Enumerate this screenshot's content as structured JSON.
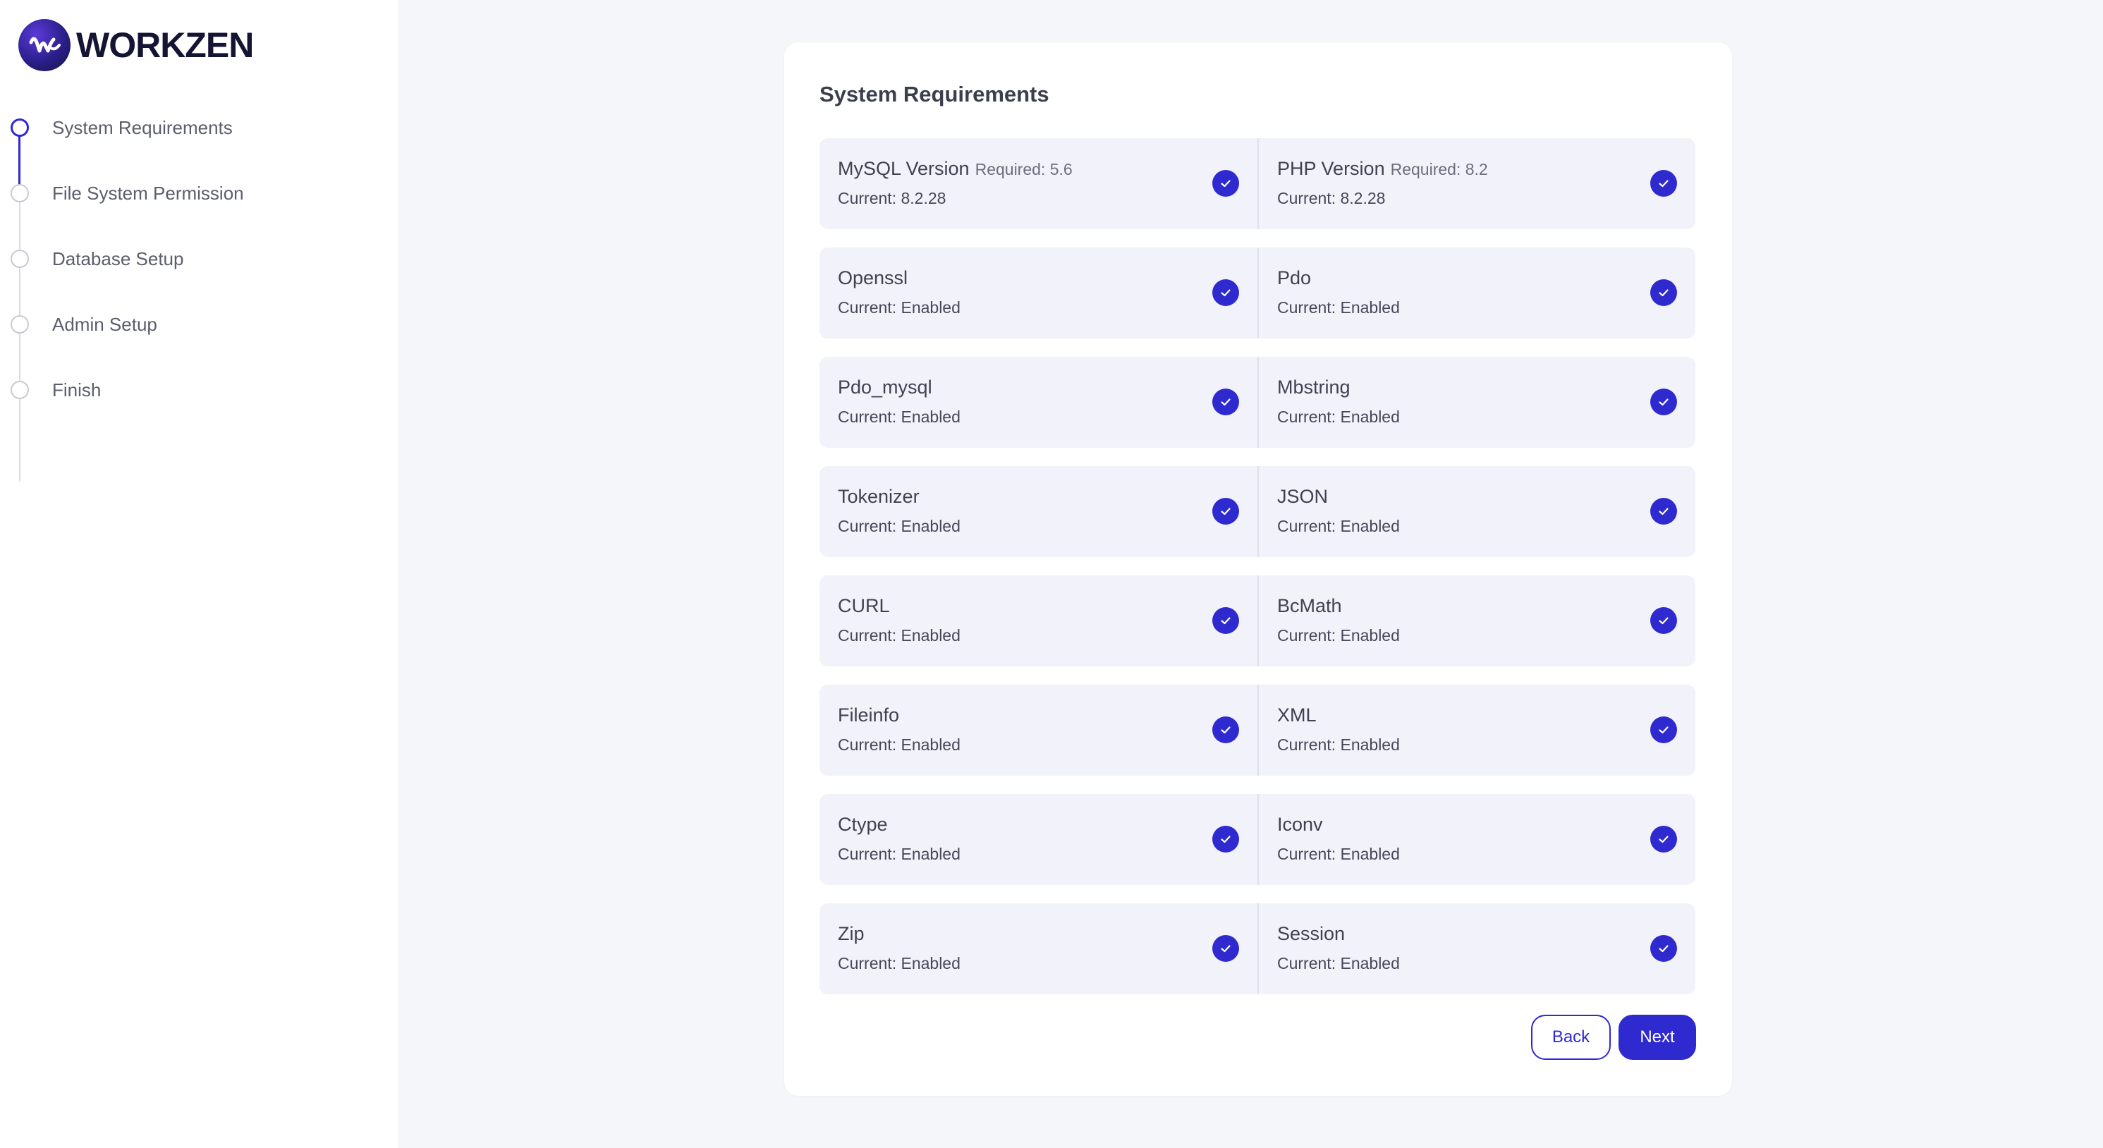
{
  "brand": {
    "name": "WORKZEN"
  },
  "steps": [
    {
      "label": "System Requirements",
      "state": "active"
    },
    {
      "label": "File System Permission",
      "state": "pending"
    },
    {
      "label": "Database Setup",
      "state": "pending"
    },
    {
      "label": "Admin Setup",
      "state": "pending"
    },
    {
      "label": "Finish",
      "state": "pending"
    }
  ],
  "main": {
    "title": "System Requirements",
    "requirements": [
      [
        {
          "name": "MySQL Version",
          "required": "Required: 5.6",
          "current": "Current: 8.2.28",
          "status": "check-icon"
        },
        {
          "name": "PHP Version",
          "required": "Required: 8.2",
          "current": "Current: 8.2.28",
          "status": "check-icon"
        }
      ],
      [
        {
          "name": "Openssl",
          "current": "Current: Enabled",
          "status": "check-icon"
        },
        {
          "name": "Pdo",
          "current": "Current: Enabled",
          "status": "check-icon"
        }
      ],
      [
        {
          "name": "Pdo_mysql",
          "current": "Current: Enabled",
          "status": "check-icon"
        },
        {
          "name": "Mbstring",
          "current": "Current: Enabled",
          "status": "check-icon"
        }
      ],
      [
        {
          "name": "Tokenizer",
          "current": "Current: Enabled",
          "status": "check-icon"
        },
        {
          "name": "JSON",
          "current": "Current: Enabled",
          "status": "check-icon"
        }
      ],
      [
        {
          "name": "CURL",
          "current": "Current: Enabled",
          "status": "check-icon"
        },
        {
          "name": "BcMath",
          "current": "Current: Enabled",
          "status": "check-icon"
        }
      ],
      [
        {
          "name": "Fileinfo",
          "current": "Current: Enabled",
          "status": "check-icon"
        },
        {
          "name": "XML",
          "current": "Current: Enabled",
          "status": "check-icon"
        }
      ],
      [
        {
          "name": "Ctype",
          "current": "Current: Enabled",
          "status": "check-icon"
        },
        {
          "name": "Iconv",
          "current": "Current: Enabled",
          "status": "check-icon"
        }
      ],
      [
        {
          "name": "Zip",
          "current": "Current: Enabled",
          "status": "check-icon"
        },
        {
          "name": "Session",
          "current": "Current: Enabled",
          "status": "check-icon"
        }
      ]
    ],
    "back_label": "Back",
    "next_label": "Next"
  },
  "colors": {
    "accent": "#2f2ad0",
    "sidebar_bg": "#ffffff",
    "page_bg": "#f5f6fa",
    "row_bg": "#f2f2fa"
  }
}
